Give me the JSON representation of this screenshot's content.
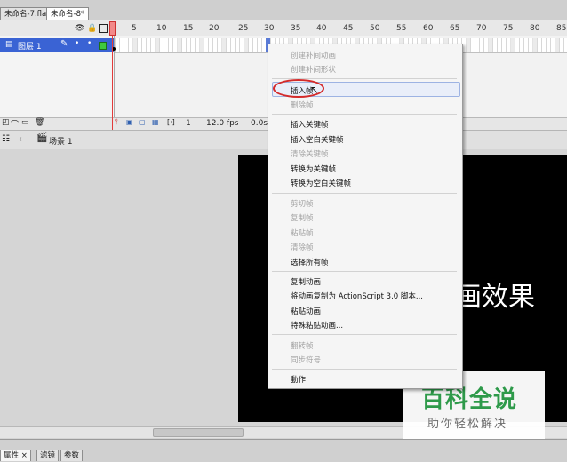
{
  "doc_tabs": [
    "未命名-7.fla",
    "未命名-8*"
  ],
  "ruler": [
    "5",
    "10",
    "15",
    "20",
    "25",
    "30",
    "35",
    "40",
    "45",
    "50",
    "55",
    "60",
    "65",
    "70",
    "75",
    "80",
    "85"
  ],
  "layer": {
    "name": "图层 1"
  },
  "timeline_status": {
    "frame": "1",
    "fps": "12.0 fps",
    "time": "0.0s"
  },
  "scene": {
    "label": "场景 1"
  },
  "stage": {
    "text": "画效果"
  },
  "context_menu": {
    "g1": [
      "创建补间动画",
      "创建补间形状"
    ],
    "g2": [
      "插入帧",
      "删除帧"
    ],
    "g3": [
      "插入关键帧",
      "插入空白关键帧",
      "清除关键帧",
      "转换为关键帧",
      "转换为空白关键帧"
    ],
    "g4": [
      "剪切帧",
      "复制帧",
      "粘贴帧",
      "清除帧",
      "选择所有帧"
    ],
    "g5": [
      "复制动画",
      "将动画复制为 ActionScript 3.0 脚本...",
      "粘贴动画",
      "特殊粘贴动画..."
    ],
    "g6": [
      "翻转帧",
      "同步符号"
    ],
    "g7": [
      "動作"
    ]
  },
  "watermark": {
    "title": "百科全说",
    "subtitle": "助你轻松解决"
  },
  "bottom_tabs": [
    "属性",
    "滤镜",
    "参数"
  ],
  "colors": {
    "layer_selected": "#3a63d4",
    "highlight_ellipse": "#d42a2a",
    "watermark_green": "#2e9a4a"
  }
}
